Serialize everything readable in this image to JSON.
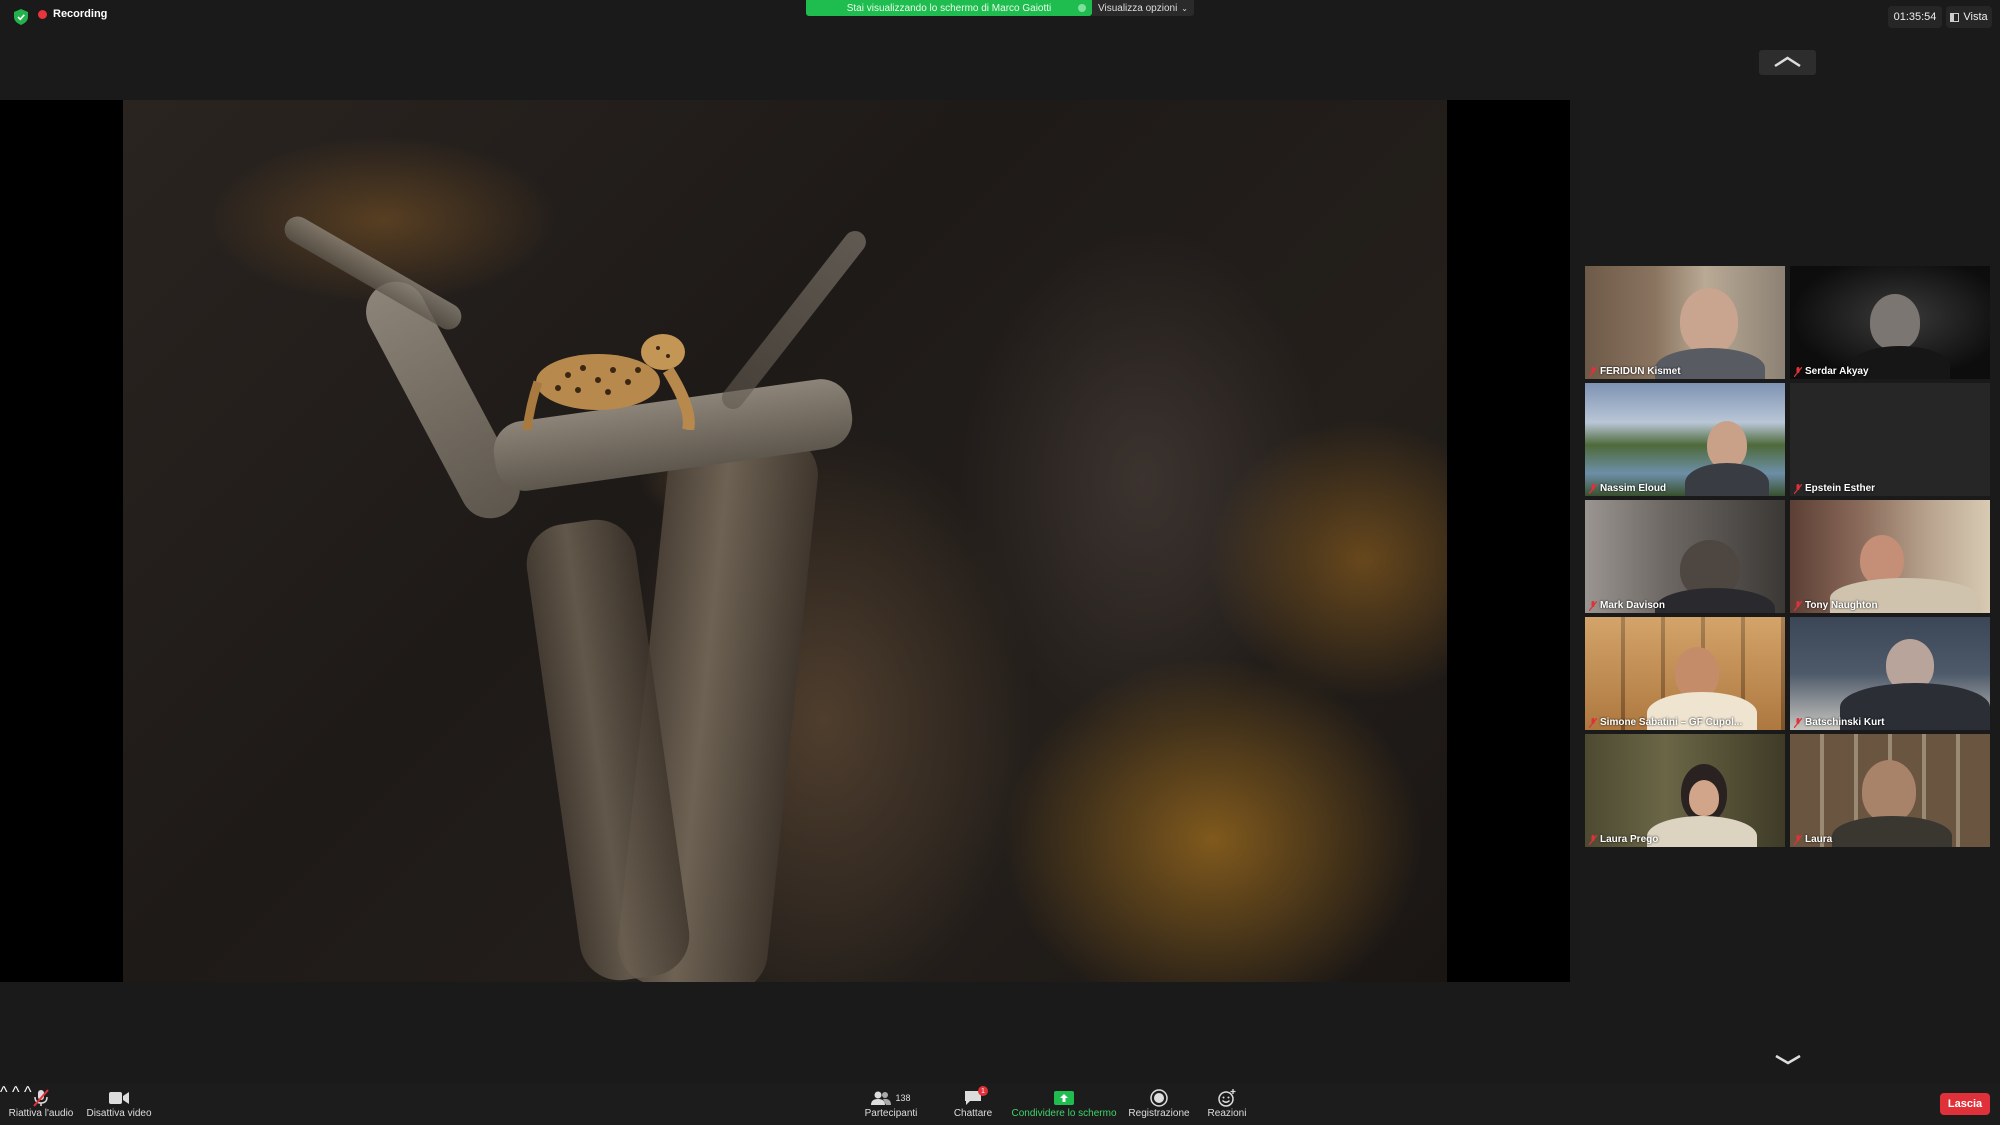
{
  "topbar": {
    "recording_label": "Recording",
    "share_banner": "Stai visualizzando lo schermo di Marco Gaiotti",
    "view_options": "Visualizza opzioni",
    "timer": "01:35:54",
    "view_label": "Vista"
  },
  "gallery": {
    "participants": [
      {
        "name": "FERIDUN Kismet"
      },
      {
        "name": "Serdar Akyay"
      },
      {
        "name": "Nassim Eloud"
      },
      {
        "name": "Epstein Esther"
      },
      {
        "name": "Mark Davison"
      },
      {
        "name": "Tony Naughton"
      },
      {
        "name": "Simone Sabatini – GF Cupol..."
      },
      {
        "name": "Batschinski Kurt"
      },
      {
        "name": "Laura Prego"
      },
      {
        "name": "Laura"
      }
    ]
  },
  "toolbar": {
    "unmute": "Riattiva l'audio",
    "stop_video": "Disattiva video",
    "participants": "Partecipanti",
    "participants_count": "138",
    "chat": "Chattare",
    "chat_badge": "1",
    "share_screen": "Condividere lo schermo",
    "record": "Registrazione",
    "reactions": "Reazioni",
    "leave": "Lascia"
  },
  "colors": {
    "share_green": "#1fbc4f",
    "leave_red": "#e0313a",
    "recording_red": "#e8343b"
  }
}
